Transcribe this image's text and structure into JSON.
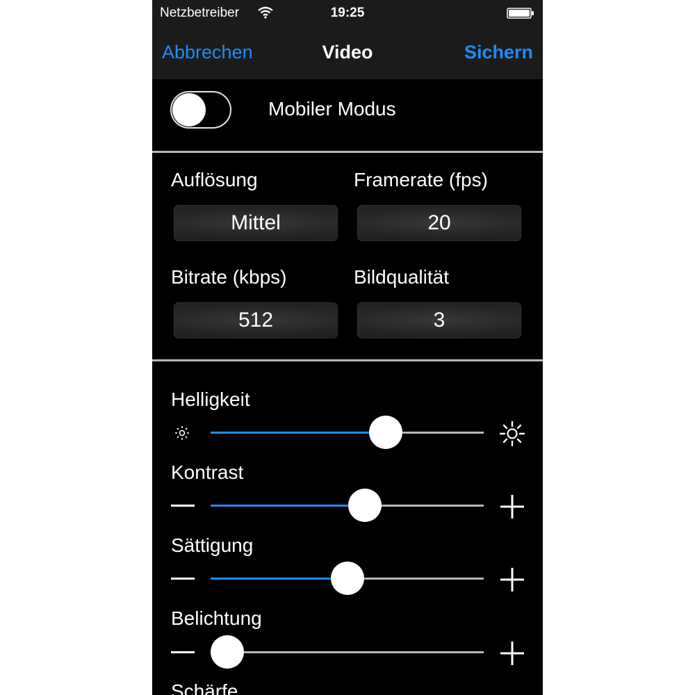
{
  "status_bar": {
    "carrier": "Netzbetreiber",
    "time": "19:25",
    "wifi_icon": "wifi-icon",
    "battery_icon": "battery-icon"
  },
  "nav": {
    "cancel_label": "Abbrechen",
    "title": "Video",
    "save_label": "Sichern"
  },
  "mobile_mode": {
    "label": "Mobiler Modus",
    "enabled": false
  },
  "settings": {
    "resolution": {
      "label": "Auflösung",
      "value": "Mittel"
    },
    "framerate": {
      "label": "Framerate (fps)",
      "value": "20"
    },
    "bitrate": {
      "label": "Bitrate (kbps)",
      "value": "512"
    },
    "quality": {
      "label": "Bildqualität",
      "value": "3"
    }
  },
  "sliders": [
    {
      "label": "Helligkeit",
      "value": 0.64,
      "min_icon": "brightness-low-icon",
      "max_icon": "brightness-high-icon"
    },
    {
      "label": "Kontrast",
      "value": 0.565,
      "min_icon": "minus-icon",
      "max_icon": "plus-icon"
    },
    {
      "label": "Sättigung",
      "value": 0.5,
      "min_icon": "minus-icon",
      "max_icon": "plus-icon"
    },
    {
      "label": "Belichtung",
      "value": 0.06,
      "min_icon": "minus-icon",
      "max_icon": "plus-icon"
    },
    {
      "label": "Schärfe"
    }
  ],
  "colors": {
    "accent": "#1e8cff",
    "background": "#000000",
    "bar": "#1b1b1b",
    "divider": "#b8b8b8"
  }
}
